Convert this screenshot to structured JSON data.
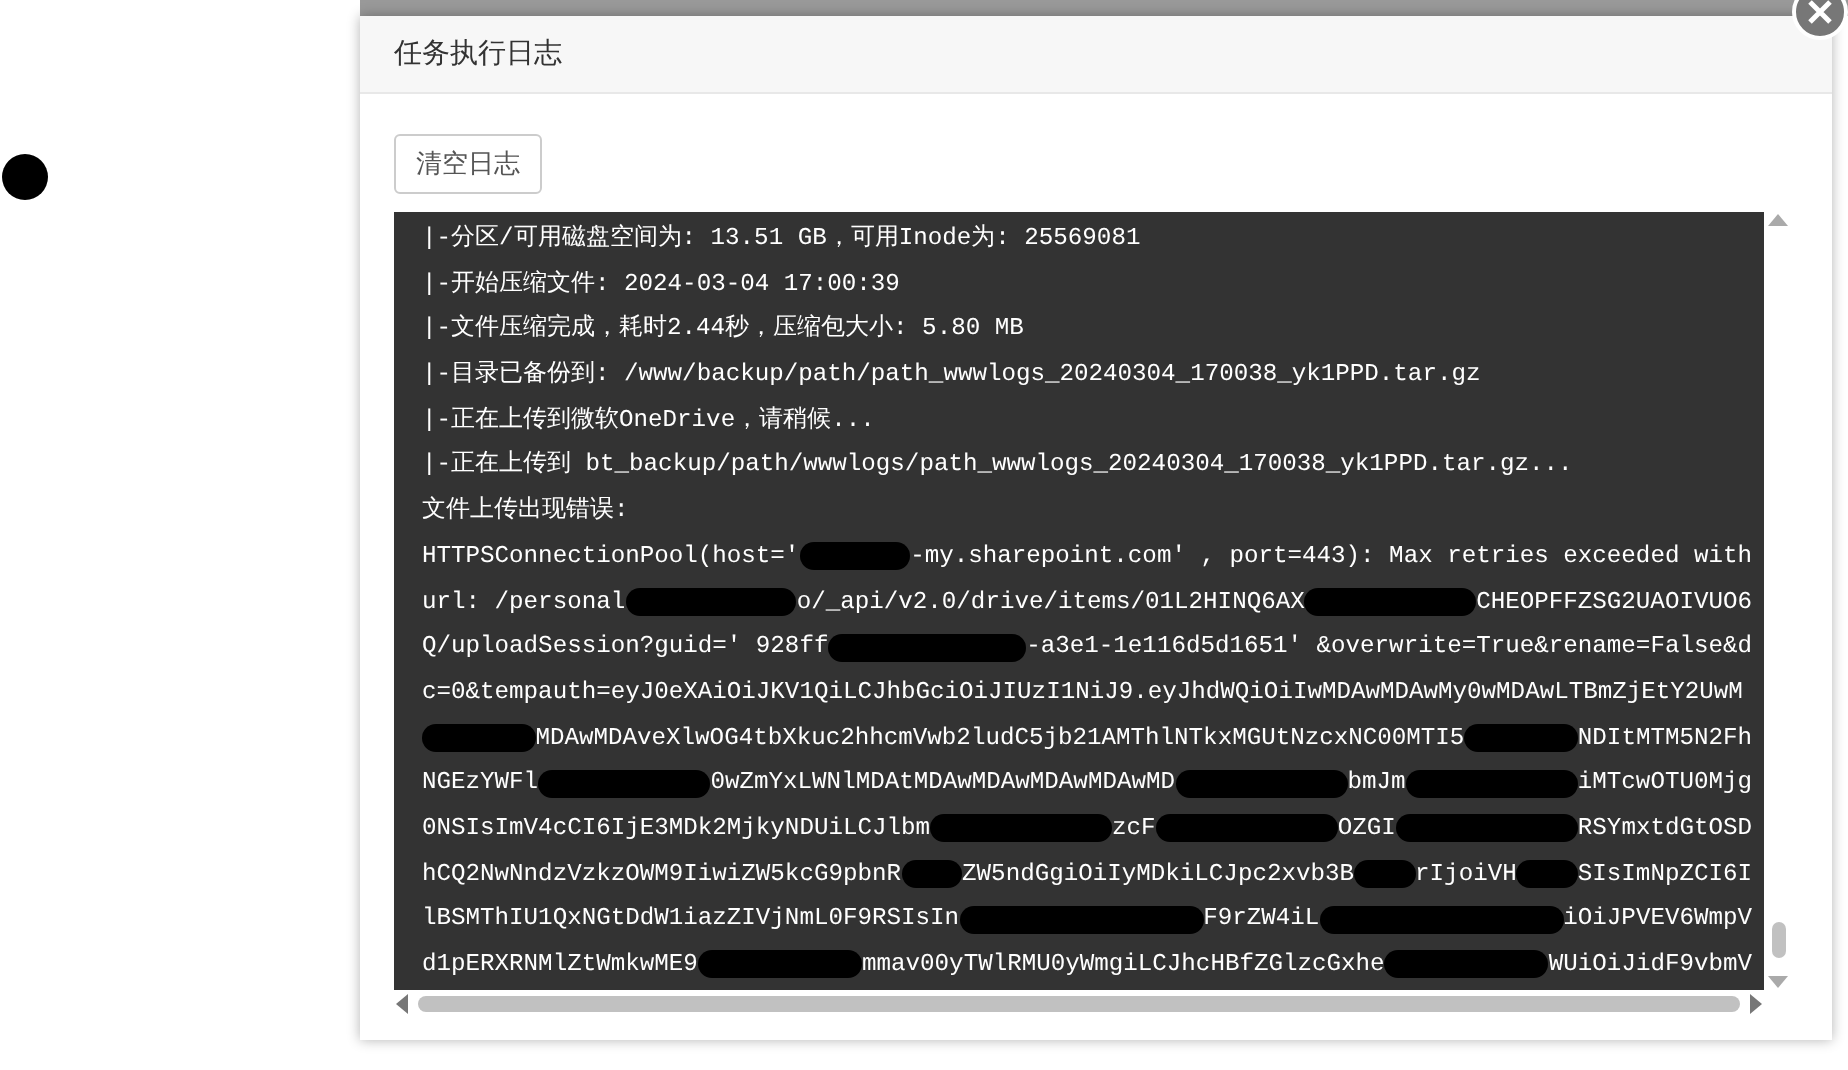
{
  "dialog": {
    "title": "任务执行日志",
    "clear_button": "清空日志",
    "log_lines": [
      {
        "segments": [
          {
            "kind": "text",
            "text": "|-分区/可用磁盘空间为: 13.51 GB，可用Inode为: 25569081"
          }
        ]
      },
      {
        "segments": [
          {
            "kind": "text",
            "text": "|-开始压缩文件: 2024-03-04 17:00:39"
          }
        ]
      },
      {
        "segments": [
          {
            "kind": "text",
            "text": "|-文件压缩完成，耗时2.44秒，压缩包大小: 5.80 MB"
          }
        ]
      },
      {
        "segments": [
          {
            "kind": "text",
            "text": "|-目录已备份到: /www/backup/path/path_wwwlogs_20240304_170038_yk1PPD.tar.gz"
          }
        ]
      },
      {
        "segments": [
          {
            "kind": "text",
            "text": "|-正在上传到微软OneDrive，请稍候..."
          }
        ]
      },
      {
        "segments": [
          {
            "kind": "text",
            "text": "|-正在上传到 bt_backup/path/wwwlogs/path_wwwlogs_20240304_170038_yk1PPD.tar.gz..."
          }
        ]
      },
      {
        "segments": [
          {
            "kind": "text",
            "text": "文件上传出现错误:"
          }
        ]
      },
      {
        "segments": [
          {
            "kind": "text",
            "text": "HTTPSConnectionPool(host='"
          },
          {
            "kind": "redaction"
          },
          {
            "kind": "text",
            "text": "-my.sharepoint.com' , port=443): Max retries exceeded with"
          }
        ]
      },
      {
        "segments": [
          {
            "kind": "text",
            "text": "url: /personal"
          },
          {
            "kind": "redaction"
          },
          {
            "kind": "text",
            "text": "o/_api/v2.0/drive/items/01L2HINQ6AX"
          },
          {
            "kind": "redaction"
          },
          {
            "kind": "text",
            "text": "CHEOPFFZSG2UAOIVUO6"
          }
        ]
      },
      {
        "segments": [
          {
            "kind": "text",
            "text": "Q/uploadSession?guid=' 928ff"
          },
          {
            "kind": "redaction"
          },
          {
            "kind": "text",
            "text": "-a3e1-1e116d5d1651' &overwrite=True&rename=False&d"
          }
        ]
      },
      {
        "segments": [
          {
            "kind": "text",
            "text": "c=0&tempauth=eyJ0eXAiOiJKV1QiLCJhbGciOiJIUzI1NiJ9.eyJhdWQiOiIwMDAwMDAwMy0wMDAwLTBmZjEtY2UwM"
          }
        ]
      },
      {
        "segments": [
          {
            "kind": "redaction"
          },
          {
            "kind": "text",
            "text": "MDAwMDAveXlwOG4tbXkuc2hhcmVwb2ludC5jb21AMThlNTkxMGUtNzcxNC00MTI5"
          },
          {
            "kind": "redaction"
          },
          {
            "kind": "text",
            "text": "NDItMTM5N2Fh"
          }
        ]
      },
      {
        "segments": [
          {
            "kind": "text",
            "text": "NGEzYWFl"
          },
          {
            "kind": "redaction"
          },
          {
            "kind": "text",
            "text": "0wZmYxLWNlMDAtMDAwMDAwMDAwMDAwMD"
          },
          {
            "kind": "redaction"
          },
          {
            "kind": "text",
            "text": "bmJm"
          },
          {
            "kind": "redaction"
          },
          {
            "kind": "text",
            "text": "iMTcwOTU0Mjg"
          }
        ]
      },
      {
        "segments": [
          {
            "kind": "text",
            "text": "0NSIsImV4cCI6IjE3MDk2MjkyNDUiLCJlbm"
          },
          {
            "kind": "redaction"
          },
          {
            "kind": "text",
            "text": "zcF"
          },
          {
            "kind": "redaction"
          },
          {
            "kind": "text",
            "text": "OZGI"
          },
          {
            "kind": "redaction"
          },
          {
            "kind": "text",
            "text": "RSYmxtdGtOSD"
          }
        ]
      },
      {
        "segments": [
          {
            "kind": "text",
            "text": "hCQ2NwNndzVzkzOWM9IiwiZW5kcG9pbnR"
          },
          {
            "kind": "redaction"
          },
          {
            "kind": "text",
            "text": "ZW5ndGgiOiIyMDkiLCJpc2xvb3B"
          },
          {
            "kind": "redaction"
          },
          {
            "kind": "text",
            "text": "rIjoiVH"
          },
          {
            "kind": "redaction"
          },
          {
            "kind": "text",
            "text": "SIsImNpZCI6I"
          }
        ]
      },
      {
        "segments": [
          {
            "kind": "text",
            "text": "lBSMThIU1QxNGtDdW1iazZIVjNmL0F9RSIsIn"
          },
          {
            "kind": "redaction"
          },
          {
            "kind": "text",
            "text": "F9rZW4iL"
          },
          {
            "kind": "redaction"
          },
          {
            "kind": "text",
            "text": "iOiJPVEV6WmpV"
          }
        ]
      },
      {
        "segments": [
          {
            "kind": "text",
            "text": "d1pERXRNMlZtWmkwME9"
          },
          {
            "kind": "redaction"
          },
          {
            "kind": "text",
            "text": "mmav00yTWlRMU0yWmgiLCJhcHBfZGlzcGxhe"
          },
          {
            "kind": "redaction"
          },
          {
            "kind": "text",
            "text": "WUiOiJidF9vbmV"
          }
        ]
      }
    ]
  }
}
